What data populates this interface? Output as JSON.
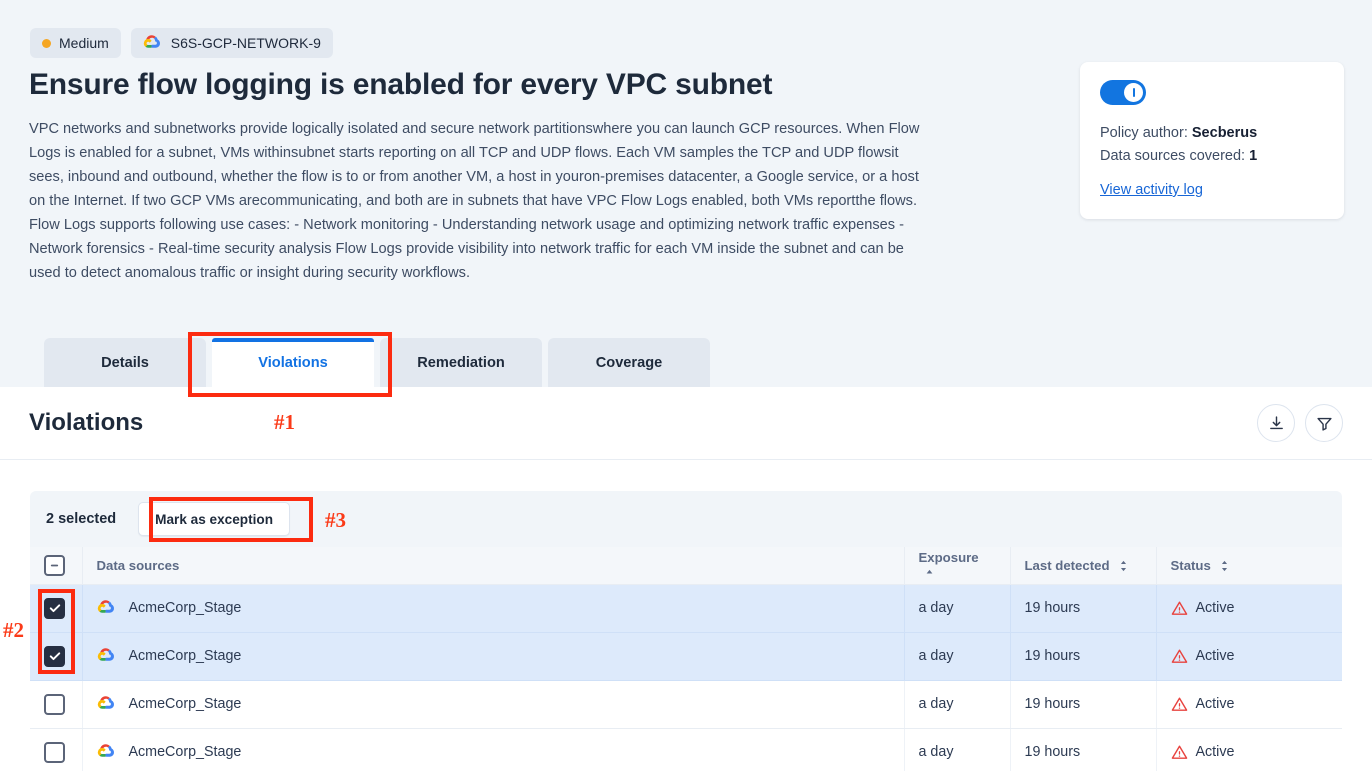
{
  "header": {
    "severity_badge": {
      "label": "Medium",
      "dot_color": "#f5a623"
    },
    "policy_id_badge": {
      "label": "S6S-GCP-NETWORK-9",
      "icon": "gcp-cloud-icon"
    },
    "title": "Ensure flow logging is enabled for every VPC subnet",
    "description": "VPC networks and subnetworks provide logically isolated and secure network partitionswhere you can launch GCP resources. When Flow Logs is enabled for a subnet, VMs withinsubnet starts reporting on all TCP and UDP flows. Each VM samples the TCP and UDP flowsit sees, inbound and outbound, whether the flow is to or from another VM, a host in youron-premises datacenter, a Google service, or a host on the Internet. If two GCP VMs arecommunicating, and both are in subnets that have VPC Flow Logs enabled, both VMs reportthe flows. Flow Logs supports following use cases: - Network monitoring - Understanding network usage and optimizing network traffic expenses - Network forensics - Real-time security analysis Flow Logs provide visibility into network traffic for each VM inside the subnet and can be used to detect anomalous traffic or insight during security workflows."
  },
  "policy_card": {
    "toggle_state": "on",
    "author_label": "Policy author:",
    "author_value": "Secberus",
    "datasources_label": "Data sources covered:",
    "datasources_value": "1",
    "activity_link": "View activity log"
  },
  "tabs": [
    {
      "label": "Details",
      "active": false
    },
    {
      "label": "Violations",
      "active": true
    },
    {
      "label": "Remediation",
      "active": false
    },
    {
      "label": "Coverage",
      "active": false
    }
  ],
  "violations_section": {
    "title": "Violations",
    "download_icon": "download-icon",
    "filter_icon": "filter-icon"
  },
  "selection_bar": {
    "selected_text": "2 selected",
    "mark_exception_label": "Mark as exception"
  },
  "table": {
    "columns": [
      {
        "label": "",
        "sort": "none"
      },
      {
        "label": "Data sources",
        "sort": "none"
      },
      {
        "label": "Exposure",
        "sort": "asc"
      },
      {
        "label": "Last detected",
        "sort": "both"
      },
      {
        "label": "Status",
        "sort": "both"
      }
    ],
    "header_checkbox_state": "indeterminate",
    "rows": [
      {
        "checked": true,
        "icon": "gcp-cloud-icon",
        "data_source": "AcmeCorp_Stage",
        "exposure": "a day",
        "last_detected": "19 hours",
        "status": "Active"
      },
      {
        "checked": true,
        "icon": "gcp-cloud-icon",
        "data_source": "AcmeCorp_Stage",
        "exposure": "a day",
        "last_detected": "19 hours",
        "status": "Active"
      },
      {
        "checked": false,
        "icon": "gcp-cloud-icon",
        "data_source": "AcmeCorp_Stage",
        "exposure": "a day",
        "last_detected": "19 hours",
        "status": "Active"
      },
      {
        "checked": false,
        "icon": "gcp-cloud-icon",
        "data_source": "AcmeCorp_Stage",
        "exposure": "a day",
        "last_detected": "19 hours",
        "status": "Active"
      }
    ]
  },
  "annotations": [
    {
      "label": "#1",
      "target": "violations-tab"
    },
    {
      "label": "#2",
      "target": "row-checkboxes"
    },
    {
      "label": "#3",
      "target": "mark-as-exception-button"
    }
  ],
  "colors": {
    "accent_blue": "#1272e3",
    "annotation_red": "#fc2b10",
    "status_red": "#e8433f",
    "selected_row": "#ddeafb",
    "header_band": "#f1f5f9"
  }
}
